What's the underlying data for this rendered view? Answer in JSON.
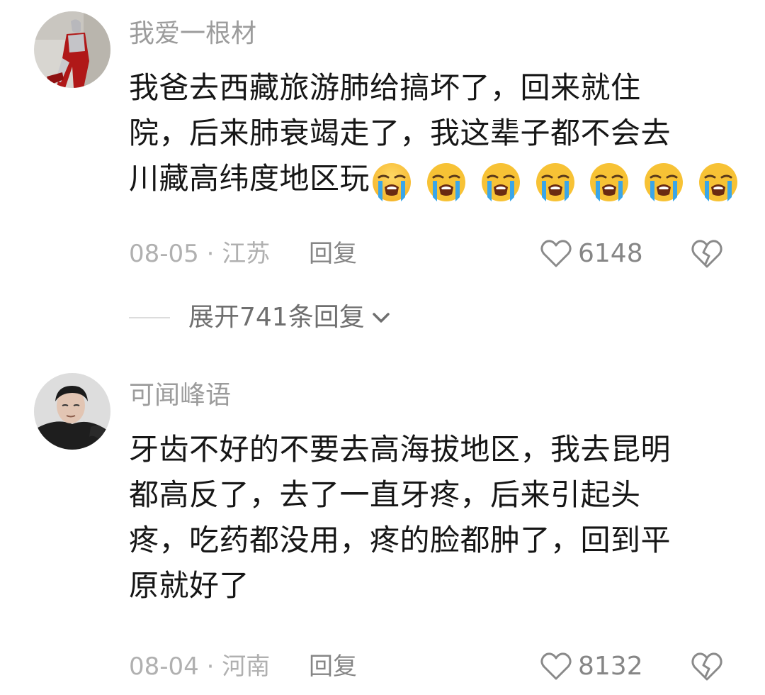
{
  "comments": [
    {
      "username": "我爱一根材",
      "lines": [
        "我爸去西藏旅游肺给搞坏了，回来就住",
        "院，后来肺衰竭走了，我这辈子都不会去",
        "川藏高纬度地区玩"
      ],
      "emoji": [
        "loudly-crying-face",
        "loudly-crying-face",
        "loudly-crying-face",
        "loudly-crying-face",
        "loudly-crying-face",
        "loudly-crying-face",
        "loudly-crying-face"
      ],
      "date": "08-05",
      "separator": "·",
      "location": "江苏",
      "reply_label": "回复",
      "likes": "6148",
      "expand_label": "展开741条回复"
    },
    {
      "username": "可闻峰语",
      "lines": [
        "牙齿不好的不要去高海拔地区，我去昆明",
        "都高反了，去了一直牙疼，后来引起头",
        "疼，吃药都没用，疼的脸都肿了，回到平",
        "原就好了"
      ],
      "date": "08-04",
      "separator": "·",
      "location": "河南",
      "reply_label": "回复",
      "likes": "8132"
    }
  ],
  "colors": {
    "username": "#9c9c9c",
    "body": "#161616",
    "meta": "#b0b0b0",
    "action": "#868686",
    "emoji_face": "#f7c235",
    "emoji_tears": "#3aa6e8"
  }
}
